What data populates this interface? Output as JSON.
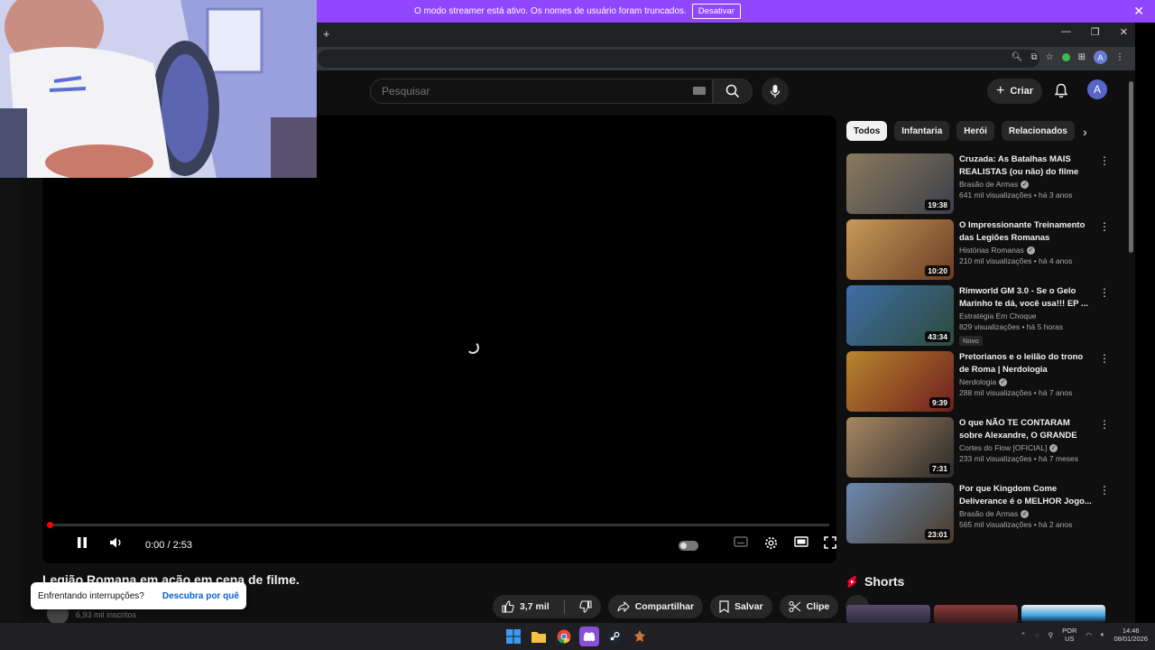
{
  "streamer_banner": {
    "message": "O modo streamer está ativo. Os nomes de usuário foram truncados.",
    "button_label": "Desativar"
  },
  "browser": {
    "new_tab_glyph": "+",
    "profile_initial": "A"
  },
  "header": {
    "search_placeholder": "Pesquisar",
    "create_label": "Criar",
    "avatar_initial": "A"
  },
  "player": {
    "time": "0:00 / 2:53",
    "progress_fraction": 0.0,
    "state": "buffering"
  },
  "video": {
    "title": "Legião Romana em ação em cena de filme.",
    "subscribers": "6,93 mil inscritos",
    "like_count": "3,7 mil",
    "share_label": "Compartilhar",
    "save_label": "Salvar",
    "clip_label": "Clipe"
  },
  "toast": {
    "message": "Enfrentando interrupções?",
    "link": "Descubra por quê"
  },
  "chips": [
    "Todos",
    "Infantaria",
    "Herói",
    "Relacionados"
  ],
  "recommendations": [
    {
      "title": "Cruzada: As Batalhas MAIS REALISTAS (ou não) do filme",
      "channel": "Brasão de Armas",
      "verified": true,
      "stats": "641 mil visualizações • há 3 anos",
      "duration": "19:38",
      "thumb_colors": [
        "#8a7a5c",
        "#3b3f4a"
      ],
      "badge": ""
    },
    {
      "title": "O Impressionante Treinamento das Legiões Romanas",
      "channel": "Histórias Romanas",
      "verified": true,
      "stats": "210 mil visualizações • há 4 anos",
      "duration": "10:20",
      "thumb_colors": [
        "#c79a5a",
        "#6b3c22"
      ],
      "badge": ""
    },
    {
      "title": "Rimworld GM 3.0 - Se o Gelo Marinho te dá, você usa!!! EP ...",
      "channel": "Estratégia Em Choque",
      "verified": false,
      "stats": "829 visualizações • há 5 horas",
      "duration": "43:34",
      "thumb_colors": [
        "#3f6ea8",
        "#2d4a3a"
      ],
      "badge": "Novo"
    },
    {
      "title": "Pretorianos e o leilão do trono de Roma | Nerdologia",
      "channel": "Nerdologia",
      "verified": true,
      "stats": "288 mil visualizações • há 7 anos",
      "duration": "9:39",
      "thumb_colors": [
        "#b8862c",
        "#6e1e1e"
      ],
      "badge": ""
    },
    {
      "title": "O que NÃO TE CONTARAM sobre Alexandre, O GRANDE",
      "channel": "Cortes do Flow [OFICIAL]",
      "verified": true,
      "stats": "233 mil visualizações • há 7 meses",
      "duration": "7:31",
      "thumb_colors": [
        "#a88662",
        "#2a2a2a"
      ],
      "badge": ""
    },
    {
      "title": "Por que Kingdom Come Deliverance é o MELHOR Jogo...",
      "channel": "Brasão de Armas",
      "verified": true,
      "stats": "565 mil visualizações • há 2 anos",
      "duration": "23:01",
      "thumb_colors": [
        "#6a8ab0",
        "#4a3a2a"
      ],
      "badge": ""
    }
  ],
  "shorts": {
    "title": "Shorts"
  },
  "taskbar": {
    "lang_top": "POR",
    "lang_bottom": "US",
    "time": "14:46",
    "date": "08/01/2026"
  }
}
